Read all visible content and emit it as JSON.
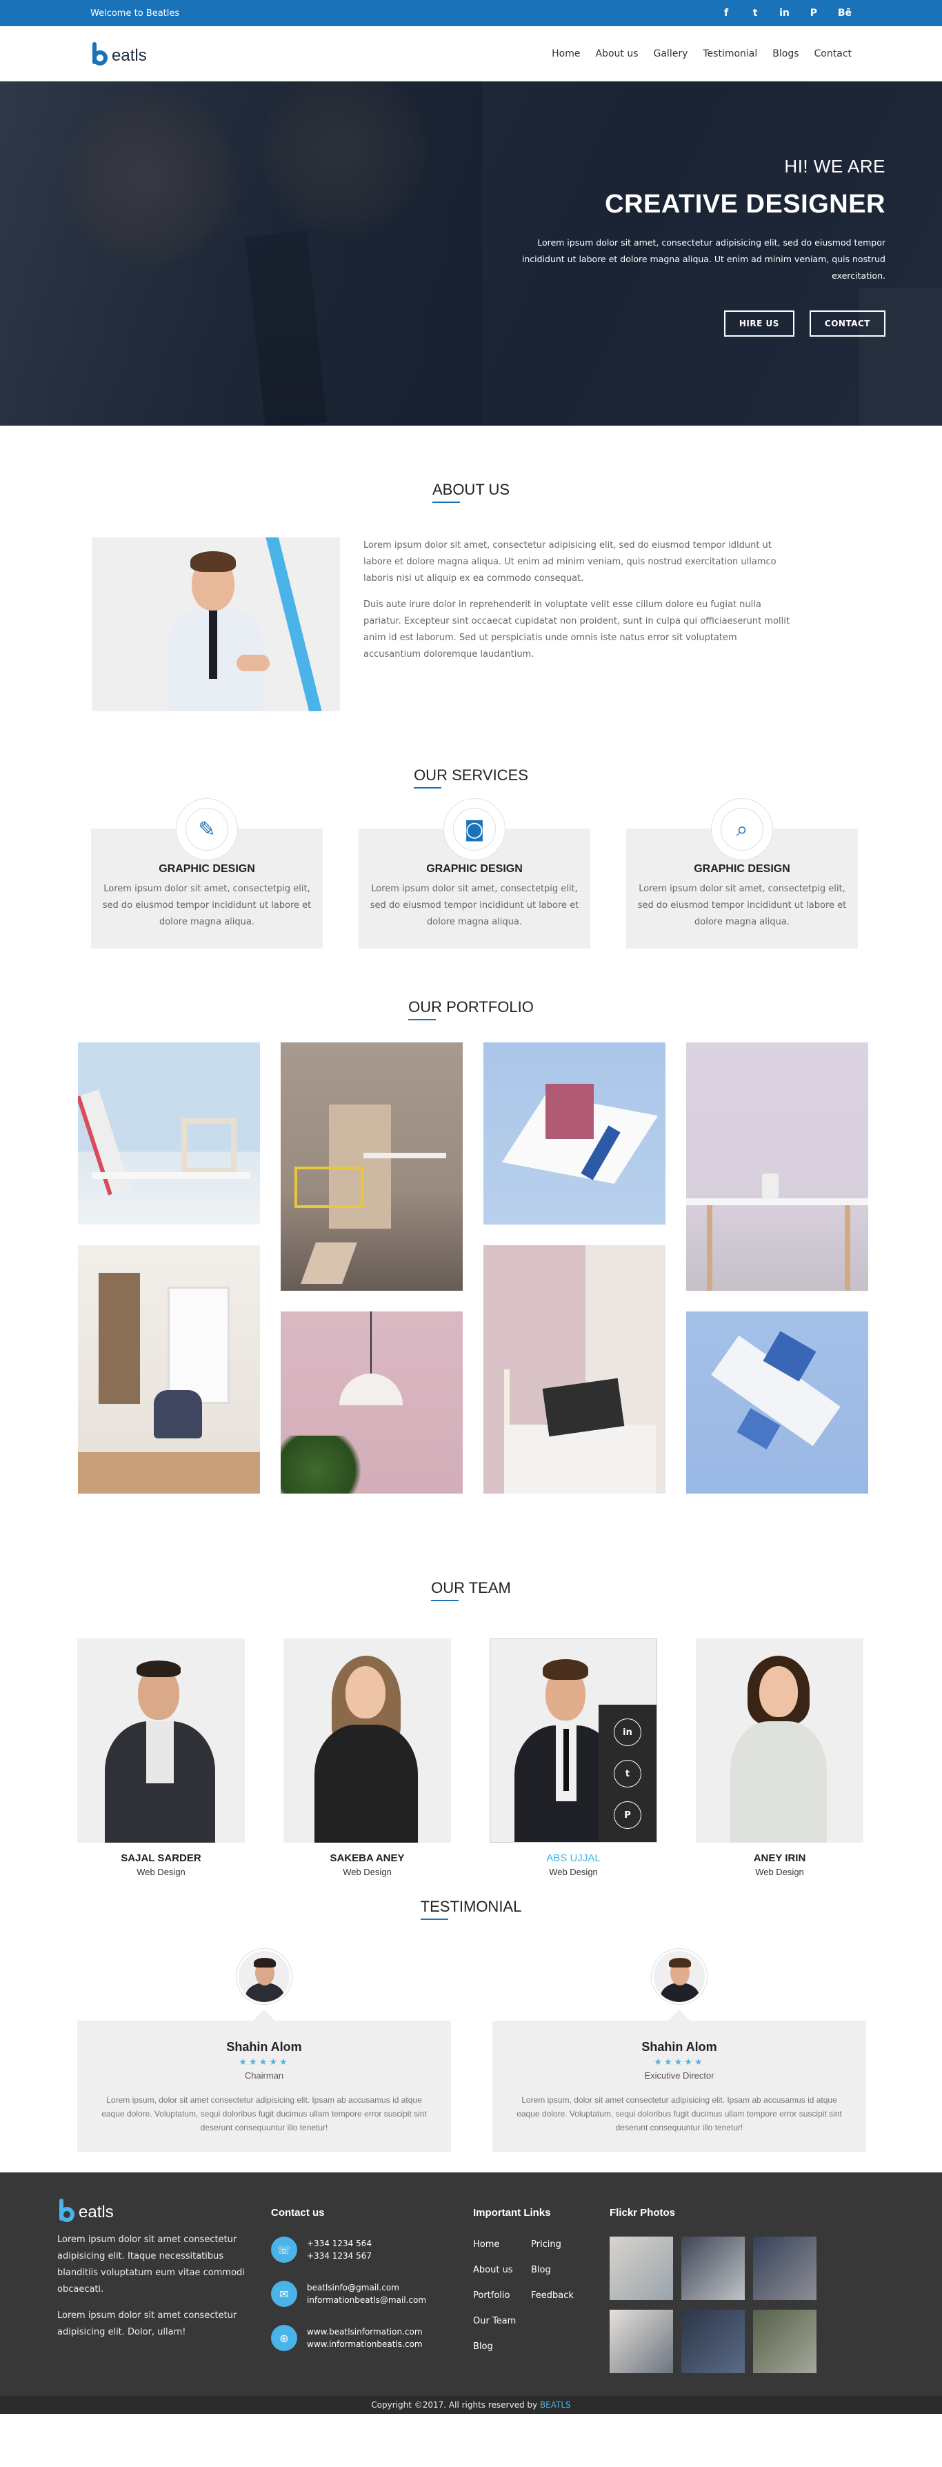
{
  "topbar": {
    "welcome": "Welcome to Beatles",
    "social": [
      {
        "icon": "facebook-icon",
        "glyph": "f"
      },
      {
        "icon": "twitter-icon",
        "glyph": "t"
      },
      {
        "icon": "linkedin-icon",
        "glyph": "in"
      },
      {
        "icon": "pinterest-icon",
        "glyph": "P"
      },
      {
        "icon": "behance-icon",
        "glyph": "Bē"
      }
    ]
  },
  "nav": {
    "logo_text": "eatls",
    "menu": [
      "Home",
      "About us",
      "Gallery",
      "Testimonial",
      "Blogs",
      "Contact"
    ]
  },
  "hero": {
    "hi": "HI! WE ARE",
    "title": "CREATIVE DESIGNER",
    "description": "Lorem ipsum dolor sit amet, consectetur adipisicing elit, sed do eiusmod tempor incididunt ut labore et dolore magna aliqua. Ut enim ad minim veniam, quis nostrud exercitation.",
    "hire_label": "HIRE US",
    "contact_label": "CONTACT"
  },
  "about": {
    "title": "ABOUT US",
    "p1": "Lorem ipsum dolor sit amet, consectetur adipisicing elit, sed do eiusmod tempor idldunt ut labore et dolore magna aliqua. Ut enim ad minim veniam, quis nostrud exercitation ullamco laboris nisi ut aliquip ex ea commodo consequat.",
    "p2": "Duis aute irure dolor in reprehenderit in voluptate velit esse cillum dolore eu fugiat nulla pariatur. Excepteur sint occaecat cupidatat non proident, sunt in culpa qui officiaeserunt mollit anim id est laborum. Sed ut perspiciatis unde omnis iste natus error sit voluptatem accusantium doloremque laudantium."
  },
  "services": {
    "title": "OUR SERVICES",
    "items": [
      {
        "icon": "pen-tool-icon",
        "glyph": "✎",
        "title": "GRAPHIC DESIGN",
        "text": "Lorem ipsum dolor sit amet, consectetpig elit, sed do eiusmod tempor incididunt ut labore et dolore magna aliqua."
      },
      {
        "icon": "camera-icon",
        "glyph": "◙",
        "title": "GRAPHIC DESIGN",
        "text": "Lorem ipsum dolor sit amet, consectetpig elit, sed do eiusmod tempor incididunt ut labore et dolore magna aliqua."
      },
      {
        "icon": "magnifier-icon",
        "glyph": "⌕",
        "title": "GRAPHIC DESIGN",
        "text": "Lorem ipsum dolor sit amet, consectetpig elit, sed do eiusmod tempor incididunt ut labore et dolore magna aliqua."
      }
    ]
  },
  "portfolio": {
    "title": "OUR PORTFOLIO"
  },
  "team": {
    "title": "OUR TEAM",
    "members": [
      {
        "name": "SAJAL SARDER",
        "role": "Web Design"
      },
      {
        "name": "SAKEBA ANEY",
        "role": "Web Design"
      },
      {
        "name": "ABS UJJAL",
        "role": "Web Design"
      },
      {
        "name": "ANEY IRIN",
        "role": "Web Design"
      }
    ],
    "hover_social": [
      "in",
      "t",
      "P"
    ]
  },
  "testimonial": {
    "title": "TESTIMONIAL",
    "items": [
      {
        "name": "Shahin Alom",
        "stars": "★★★★★",
        "position": "Chairman",
        "quote": "Lorem ipsum, dolor sit amet consectetur adipisicing elit. Ipsam ab accusamus id atque eaque dolore. Voluptatum, sequi doloribus fugit ducimus ullam tempore error suscipit sint deserunt consequuntur illo tenetur!"
      },
      {
        "name": "Shahin Alom",
        "stars": "★★★★★",
        "position": "Exicutive Director",
        "quote": "Lorem ipsum, dolor sit amet consectetur adipisicing elit. Ipsam ab accusamus id atque eaque dolore. Voluptatum, sequi doloribus fugit ducimus ullam tempore error suscipit sint deserunt consequuntur illo tenetur!"
      }
    ]
  },
  "footer": {
    "logo_text": "eatls",
    "p1": "Lorem ipsum dolor sit amet consectetur adipisicing elit. Itaque necessitatibus blanditiis voluptatum eum vitae commodi obcaecati.",
    "p2": "Lorem ipsum dolor sit amet consectetur adipisicing elit. Dolor, ullam!",
    "contact_title": "Contact us",
    "phone1": "+334 1234 564",
    "phone2": "+334 1234 567",
    "email1": "beatlsinfo@gmail.com",
    "email2": "informationbeatls@mail.com",
    "web1": "www.beatlsinformation.com",
    "web2": "www.informationbeatls.com",
    "links_title": "Important Links",
    "links": [
      "Home",
      "Pricing",
      "About us",
      "Blog",
      "Portfolio",
      "Feedback",
      "Our Team",
      "",
      "Blog",
      ""
    ],
    "flickr_title": "Flickr Photos",
    "copyright": "Copyright ©2017. All rights reserved by",
    "brand": "BEATLS"
  },
  "colors": {
    "accent": "#1a72b8",
    "accent_light": "#4ab3e8",
    "footer_bg": "#383838"
  }
}
